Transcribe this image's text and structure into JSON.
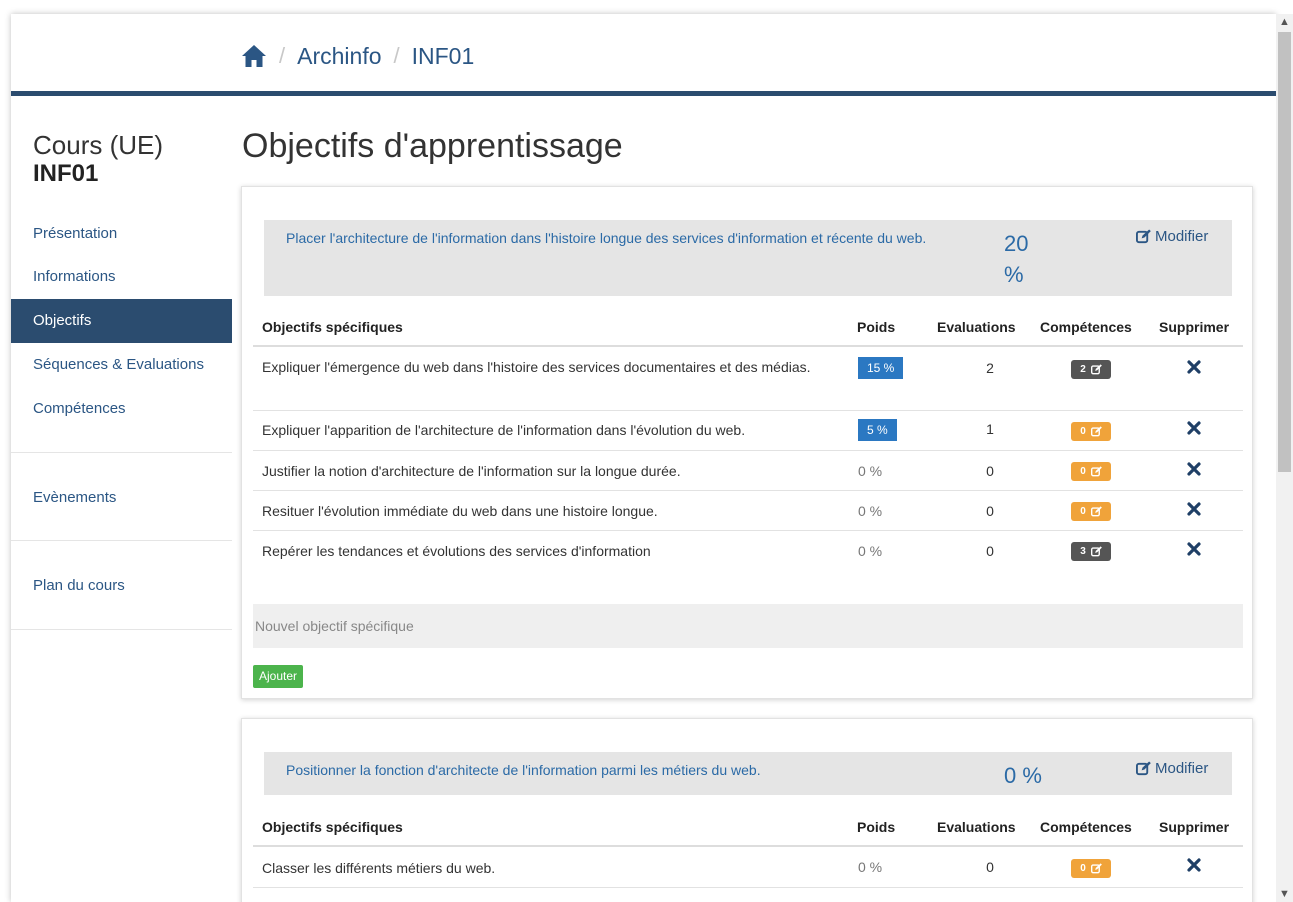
{
  "breadcrumb": {
    "home_icon": "home-icon",
    "items": [
      "Archinfo",
      "INF01"
    ],
    "separator": "/"
  },
  "sidebar": {
    "course_label": "Cours (UE)",
    "course_code": "INF01",
    "items": [
      {
        "label": "Présentation"
      },
      {
        "label": "Informations"
      },
      {
        "label": "Objectifs",
        "active": true
      },
      {
        "label": "Séquences & Evaluations"
      },
      {
        "label": "Compétences"
      },
      {
        "label": "Evènements"
      },
      {
        "label": "Plan du cours"
      }
    ]
  },
  "main": {
    "title": "Objectifs d'apprentissage",
    "columns": [
      "Objectifs spécifiques",
      "Poids",
      "Evaluations",
      "Compétences",
      "Supprimer"
    ],
    "modify_label": "Modifier",
    "new_placeholder": "Nouvel objectif spécifique",
    "add_label": "Ajouter",
    "objectives": [
      {
        "title": "Placer l'architecture de l'information dans l'histoire longue des services d'information et récente du web.",
        "weight_value": "20",
        "weight_unit": "%",
        "specifics": [
          {
            "name": "Expliquer l'émergence du web dans l'histoire des services documentaires et des médias.",
            "weight": "15 %",
            "evaluations": "2",
            "competences": "2"
          },
          {
            "name": "Expliquer l'apparition de l'architecture de l'information dans l'évolution du web.",
            "weight": "5 %",
            "evaluations": "1",
            "competences": "0"
          },
          {
            "name": "Justifier la notion d'architecture de l'information sur la longue durée.",
            "weight": "0 %",
            "evaluations": "0",
            "competences": "0"
          },
          {
            "name": "Resituer l'évolution immédiate du web dans une histoire longue.",
            "weight": "0 %",
            "evaluations": "0",
            "competences": "0"
          },
          {
            "name": "Repérer les tendances et évolutions des services d'information",
            "weight": "0 %",
            "evaluations": "0",
            "competences": "3"
          }
        ]
      },
      {
        "title": "Positionner la fonction d'architecte de l'information parmi les métiers du web.",
        "weight_value": "0 %",
        "specifics": [
          {
            "name": "Classer les différents métiers du web.",
            "weight": "0 %",
            "evaluations": "0",
            "competences": "0"
          }
        ]
      }
    ]
  },
  "colors": {
    "primary": "#2b4c6f",
    "link": "#2b5684",
    "weight_badge": "#2b78c2",
    "competence_zero": "#f0a33a",
    "competence_nonzero": "#555555",
    "add_button": "#4cb44c"
  },
  "icons": {
    "modify": "edit-icon",
    "delete": "close-icon",
    "competence": "edit-icon"
  }
}
